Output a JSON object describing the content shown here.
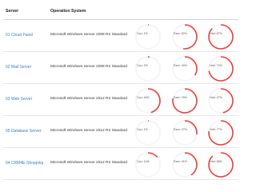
{
  "header": {
    "server": "Server",
    "os": "Operation System"
  },
  "colors": {
    "gauge": "#e8413a",
    "link": "#3a7bbf"
  },
  "rows": [
    {
      "server": "01 Cloud Panel",
      "os": "Microsoft Windows Server 2008 R2 Standard",
      "cpu": {
        "label": "Cpu: 1%",
        "value": 1
      },
      "ram": {
        "label": "Ram: 52%",
        "value": 52
      },
      "hdd": {
        "label": "Hdd: 87%",
        "value": 87
      }
    },
    {
      "server": "02 Mail Server",
      "os": "Microsoft Windows Server 2008 R2 Standard",
      "cpu": {
        "label": "Cpu: 2%",
        "value": 2
      },
      "ram": {
        "label": "Ram: 34%",
        "value": 34
      },
      "hdd": {
        "label": "Hdd: 72%",
        "value": 72
      }
    },
    {
      "server": "03 Web Server",
      "os": "Microsoft Windows Server 2012 R2 Standard",
      "cpu": {
        "label": "Cpu: 46%",
        "value": 46
      },
      "ram": {
        "label": "Ram: 78%",
        "value": 78
      },
      "hdd": {
        "label": "Hdd: 47%",
        "value": 47
      }
    },
    {
      "server": "05 Database Server",
      "os": "Microsoft Windows Server 2012 R2 Standard",
      "cpu": {
        "label": "Cpu: 1%",
        "value": 1
      },
      "ram": {
        "label": "Ram: 27%",
        "value": 27
      },
      "hdd": {
        "label": "Hdd: 77%",
        "value": 77
      }
    },
    {
      "server": "04 CRM4E-Shopping",
      "os": "Microsoft Windows Server 2012 R2 Standard",
      "cpu": {
        "label": "Cpu: 14%",
        "value": 14
      },
      "ram": {
        "label": "Ram: 41%",
        "value": 41
      },
      "hdd": {
        "label": "Hdd: 88%",
        "value": 88
      }
    }
  ]
}
